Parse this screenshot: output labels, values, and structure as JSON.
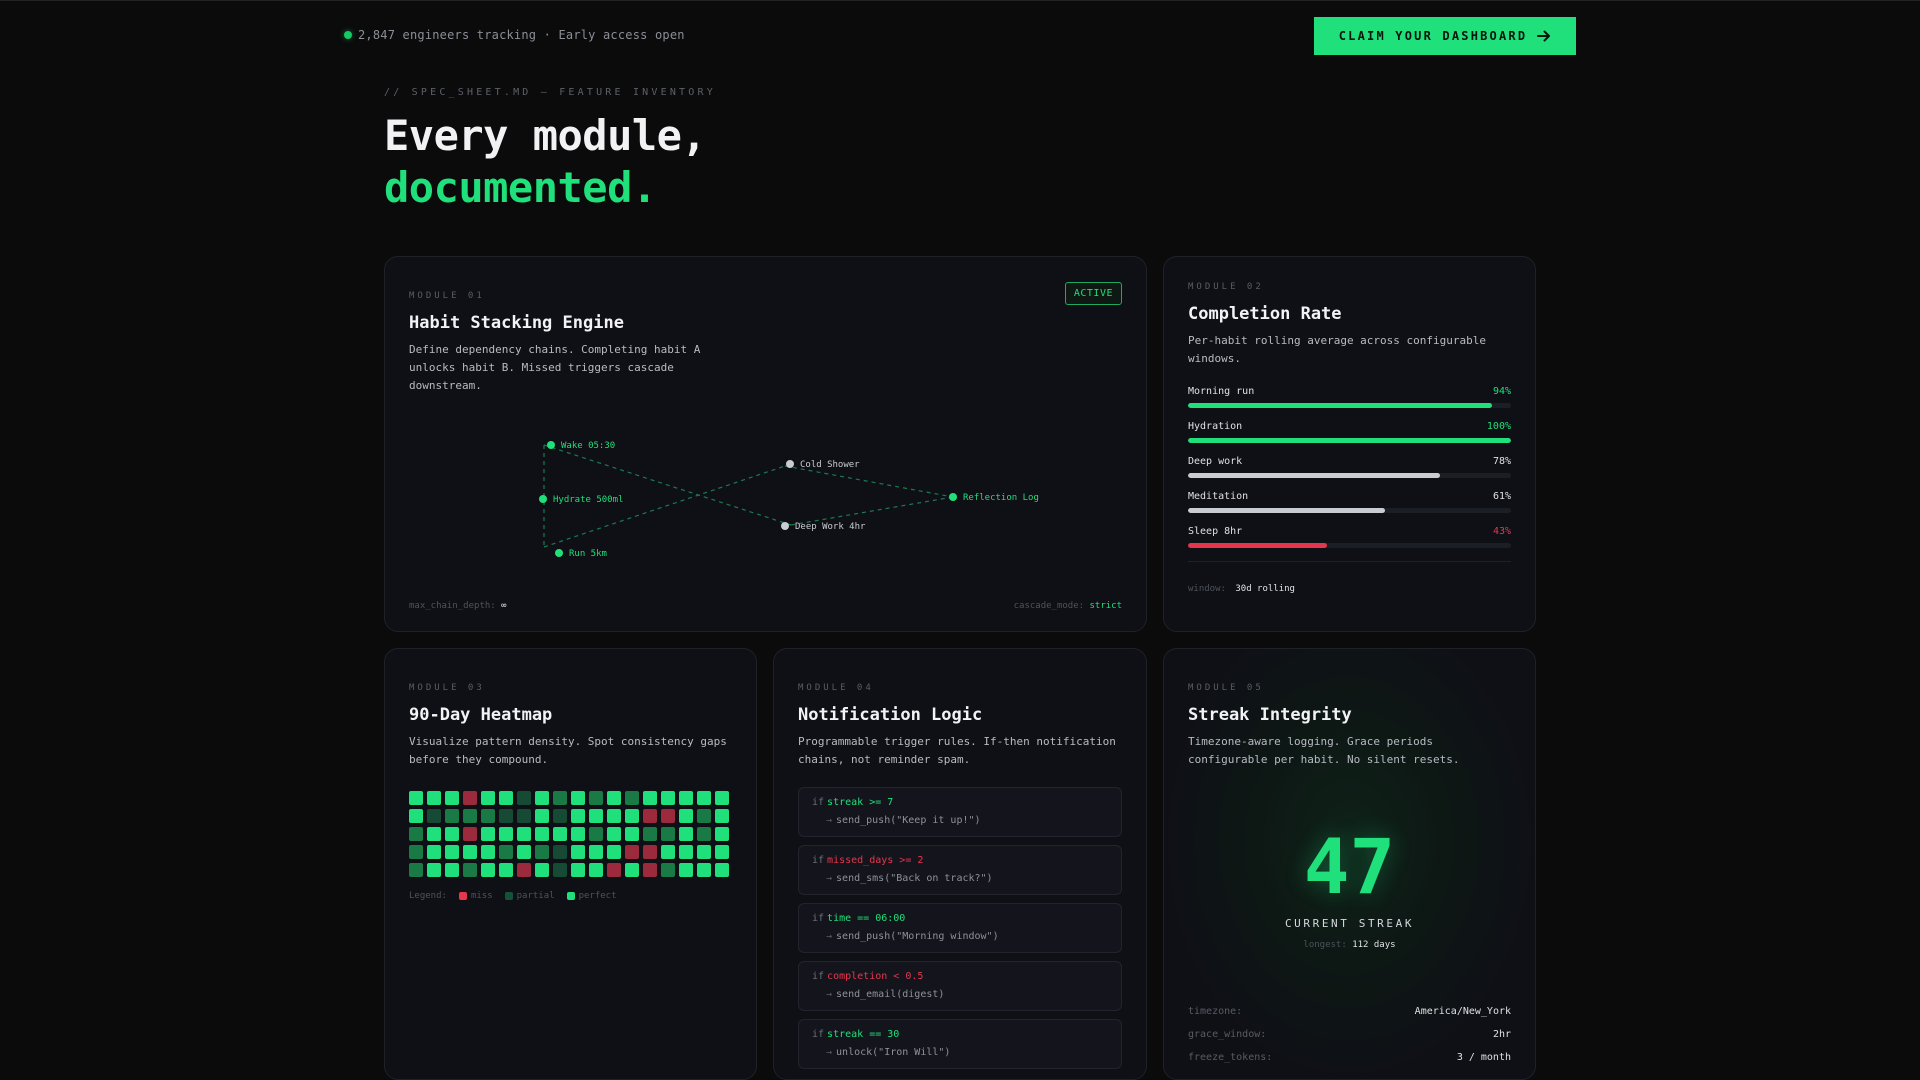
{
  "header": {
    "status_text": "2,847 engineers tracking · Early access open",
    "cta_label": "CLAIM YOUR DASHBOARD"
  },
  "hero": {
    "eyebrow": "// SPEC_SHEET.MD — FEATURE INVENTORY",
    "title_line1": "Every module,",
    "title_line2": "documented."
  },
  "colors": {
    "accent": "#1fe07a",
    "danger": "#e5364e",
    "neutral_bar": "#c9ccd2",
    "heat_perfect": "#1fe07a",
    "heat_partial": "#1a7a45",
    "heat_dim": "#164a34",
    "heat_miss": "#9b2a3c"
  },
  "module1": {
    "label": "MODULE 01",
    "title": "Habit Stacking Engine",
    "description": "Define dependency chains. Completing habit A unlocks habit B. Missed triggers cascade downstream.",
    "badge": "ACTIVE",
    "nodes": [
      {
        "label": "Wake 05:30",
        "state": "active"
      },
      {
        "label": "Hydrate 500ml",
        "state": "active"
      },
      {
        "label": "Run 5km",
        "state": "active"
      },
      {
        "label": "Cold Shower",
        "state": "inactive"
      },
      {
        "label": "Deep Work 4hr",
        "state": "inactive"
      },
      {
        "label": "Reflection Log",
        "state": "active"
      }
    ],
    "footer_left_key": "max_chain_depth:",
    "footer_left_value": "∞",
    "footer_right_key": "cascade_mode:",
    "footer_right_value": "strict"
  },
  "module2": {
    "label": "MODULE 02",
    "title": "Completion Rate",
    "description": "Per-habit rolling average across configurable windows.",
    "bars": [
      {
        "name": "Morning run",
        "value": 94,
        "value_label": "94%",
        "status": "good"
      },
      {
        "name": "Hydration",
        "value": 100,
        "value_label": "100%",
        "status": "good"
      },
      {
        "name": "Deep work",
        "value": 78,
        "value_label": "78%",
        "status": "neutral"
      },
      {
        "name": "Meditation",
        "value": 61,
        "value_label": "61%",
        "status": "neutral"
      },
      {
        "name": "Sleep 8hr",
        "value": 43,
        "value_label": "43%",
        "status": "bad"
      }
    ],
    "window_key": "window:",
    "window_value": "30d rolling"
  },
  "module3": {
    "label": "MODULE 03",
    "title": "90-Day Heatmap",
    "description": "Visualize pattern density. Spot consistency gaps before they compound.",
    "heatmap": [
      "pppmppdpapapappppp",
      "pdaaaddpdppppmmpap",
      "appmppppppappaapap",
      "appppapadpppmmpppp",
      "appappmpdppmpmappp"
    ],
    "legend_label": "Legend:",
    "legend": [
      {
        "label": "miss",
        "key": "miss"
      },
      {
        "label": "partial",
        "key": "partial"
      },
      {
        "label": "perfect",
        "key": "perfect"
      }
    ]
  },
  "module4": {
    "label": "MODULE 04",
    "title": "Notification Logic",
    "description": "Programmable trigger rules. If-then notification chains, not reminder spam.",
    "rules": [
      {
        "kw": "if",
        "condition": "streak >= 7",
        "tone": "good",
        "action": "send_push(\"Keep it up!\")"
      },
      {
        "kw": "if",
        "condition": "missed_days >= 2",
        "tone": "bad",
        "action": "send_sms(\"Back on track?\")"
      },
      {
        "kw": "if",
        "condition": "time == 06:00",
        "tone": "good",
        "action": "send_push(\"Morning window\")"
      },
      {
        "kw": "if",
        "condition": "completion < 0.5",
        "tone": "bad",
        "action": "send_email(digest)"
      },
      {
        "kw": "if",
        "condition": "streak == 30",
        "tone": "good",
        "action": "unlock(\"Iron Will\")"
      }
    ]
  },
  "module5": {
    "label": "MODULE 05",
    "title": "Streak Integrity",
    "description": "Timezone-aware logging. Grace periods configurable per habit. No silent resets.",
    "streak": "47",
    "streak_label": "CURRENT STREAK",
    "longest_key": "longest:",
    "longest_value": "112 days",
    "settings": [
      {
        "key": "timezone:",
        "value": "America/New_York"
      },
      {
        "key": "grace_window:",
        "value": "2hr"
      },
      {
        "key": "freeze_tokens:",
        "value": "3 / month"
      }
    ]
  }
}
